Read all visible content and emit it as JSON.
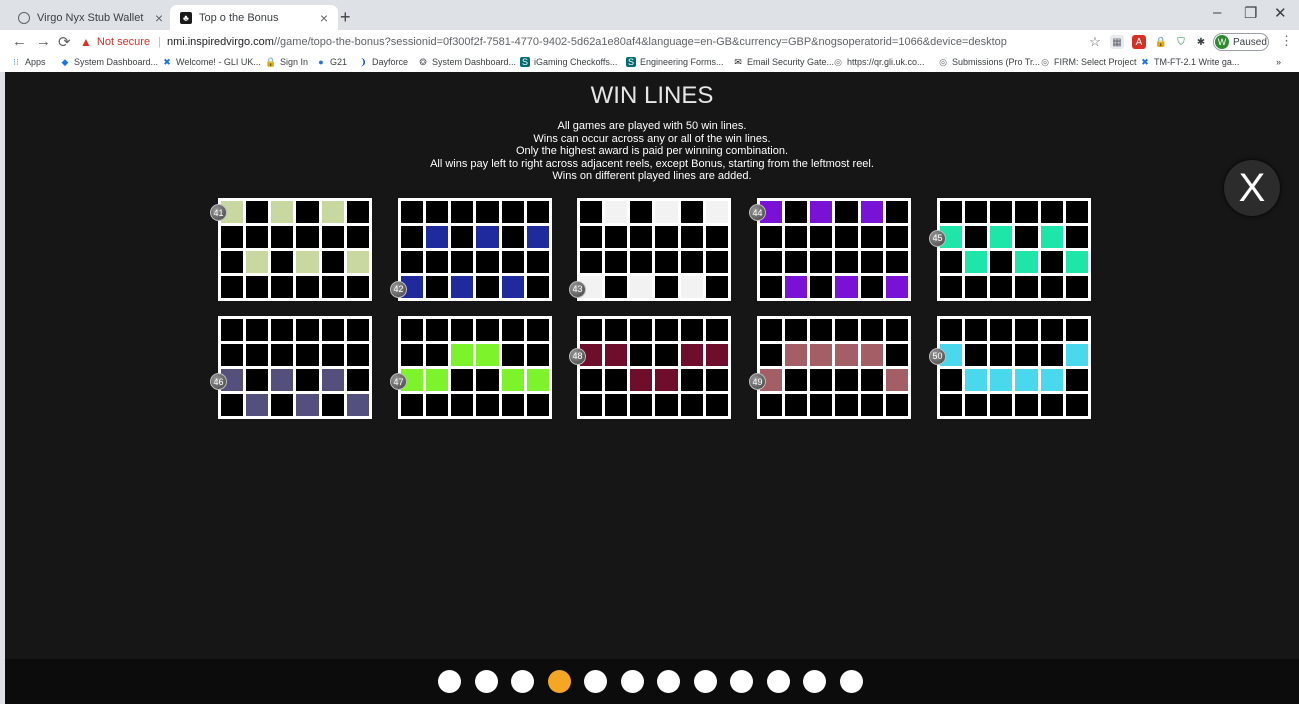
{
  "browser": {
    "tabs": [
      {
        "title": "Virgo Nyx Stub Wallet",
        "icon": "globe-icon"
      },
      {
        "title": "Top o the Bonus",
        "icon": "game-icon"
      }
    ],
    "url": {
      "security": "Not secure",
      "host": "nmi.inspiredvirgo.com",
      "path": "//game/topo-the-bonus?sessionid=0f300f2f-7581-4770-9402-5d62a1e80af4&language=en-GB&currency=GBP&nogsoperatorid=1066&device=desktop"
    },
    "profile_status": "Paused",
    "profile_initial": "W",
    "bookmarks": [
      "Apps",
      "System Dashboard...",
      "Welcome! - GLI UK...",
      "Sign In",
      "G21",
      "Dayforce",
      "System Dashboard...",
      "iGaming Checkoffs...",
      "Engineering Forms...",
      "Email Security Gate...",
      "https://qr.gli.uk.co...",
      "Submissions (Pro Tr...",
      "FIRM: Select Project",
      "TM-FT-2.1 Write ga..."
    ]
  },
  "game": {
    "title": "WIN LINES",
    "intro": [
      "All games are played with 50 win lines.",
      "Wins can occur across any or all of the win lines.",
      "Only the highest award is paid per winning combination.",
      "All wins pay left to right across adjacent reels, except Bonus, starting from the leftmost reel.",
      "Wins on different played lines are added."
    ],
    "close_label": "X",
    "win_lines": [
      {
        "number": "41",
        "color": "#c8d8a0",
        "rows": [
          0,
          2,
          0,
          2,
          0,
          2
        ]
      },
      {
        "number": "42",
        "color": "#1f2a9c",
        "rows": [
          3,
          1,
          3,
          1,
          3,
          1
        ]
      },
      {
        "number": "43",
        "color": "#f2f2f2",
        "rows": [
          3,
          0,
          3,
          0,
          3,
          0
        ]
      },
      {
        "number": "44",
        "color": "#7a12d6",
        "rows": [
          0,
          3,
          0,
          3,
          0,
          3
        ]
      },
      {
        "number": "45",
        "color": "#1de6a8",
        "rows": [
          1,
          2,
          1,
          2,
          1,
          2
        ]
      },
      {
        "number": "46",
        "color": "#54507e",
        "rows": [
          2,
          3,
          2,
          3,
          2,
          3
        ]
      },
      {
        "number": "47",
        "color": "#7cf32a",
        "rows": [
          2,
          2,
          1,
          1,
          2,
          2
        ]
      },
      {
        "number": "48",
        "color": "#6e0d2c",
        "rows": [
          1,
          1,
          2,
          2,
          1,
          1
        ]
      },
      {
        "number": "49",
        "color": "#a35e66",
        "rows": [
          2,
          1,
          1,
          1,
          1,
          2
        ]
      },
      {
        "number": "50",
        "color": "#4ad8ec",
        "rows": [
          1,
          2,
          2,
          2,
          2,
          1
        ]
      }
    ],
    "pages": {
      "total": 12,
      "current": 4
    }
  }
}
